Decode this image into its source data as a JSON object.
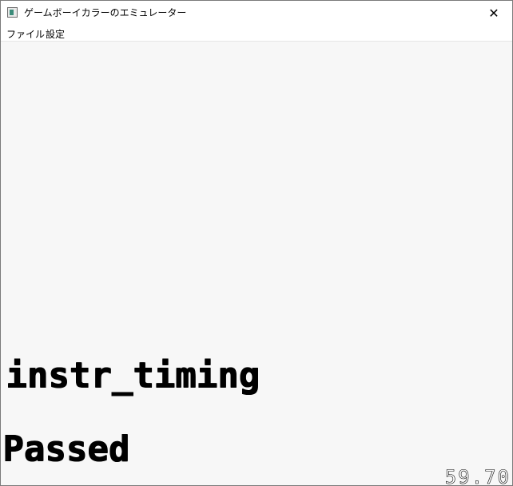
{
  "window": {
    "title": "ゲームボーイカラーのエミュレーター",
    "close_glyph": "✕"
  },
  "menubar": {
    "items": [
      "ファイル",
      "設定"
    ]
  },
  "screen": {
    "line1": "instr_timing",
    "line2": "Passed",
    "fps": "59.70",
    "background": "#f7f7f7"
  }
}
